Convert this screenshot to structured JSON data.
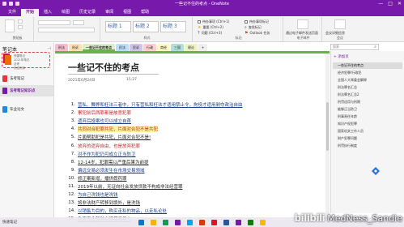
{
  "window": {
    "title": "一些记不住的考点 - OneNote",
    "controls": [
      "—",
      "□",
      "✕"
    ]
  },
  "ribbon_tabs": [
    "文件",
    "开始",
    "插入",
    "绘图",
    "历史记录",
    "审阅",
    "视图",
    "帮助"
  ],
  "ribbon": {
    "clipboard_label": "剪贴板",
    "styles": [
      "标题 1",
      "标题 2",
      "标题 3"
    ],
    "styles_label": "样式",
    "tags": [
      "待办事项 (Ctrl+1)",
      "重要 (Ctrl+2)",
      "问题 (Ctrl+3)"
    ],
    "tags_label": "标记",
    "todo_button": "待办事项标记",
    "find_tags": "查找标记",
    "outlook_tasks": "Outlook 任务",
    "email_page": "通过电子邮件发送页面",
    "email_label": "电子邮件",
    "meeting_details": "会议详细信息",
    "meetings_label": "会议"
  },
  "left_panel": {
    "header": "笔记本",
    "thumb_lines": [
      "快捷笔记",
      "2021年笔记",
      "法考",
      "刑法刑诉"
    ],
    "notebooks": [
      {
        "label": "法考笔记",
        "color": "#e53935"
      },
      {
        "label": "法考笔记知识点",
        "color": "#7719aa"
      },
      {
        "label": "毕业论文",
        "color": "#1e88e5"
      }
    ],
    "footer": "快速笔记"
  },
  "section_tabs": [
    {
      "label": "刑法",
      "color": "#f8bbd0"
    },
    {
      "label": "刑诉",
      "color": "#ffe0b2"
    },
    {
      "label": "一些记不住的考点",
      "color": "#dcedc8"
    },
    {
      "label": "民法",
      "color": "#bbdefb"
    },
    {
      "label": "民诉",
      "color": "#d1c4e9"
    },
    {
      "label": "行政",
      "color": "#ffcdd2"
    },
    {
      "label": "商经",
      "color": "#fff9c4"
    },
    {
      "label": "三国",
      "color": "#b2dfdb"
    },
    {
      "label": "理论",
      "color": "#f0f4c3"
    },
    {
      "label": "+",
      "color": "#eeeeee"
    }
  ],
  "search": {
    "placeholder": "搜索"
  },
  "page": {
    "title": "一些记不住的考点",
    "date": "2021年6月24日",
    "time": "15:27"
  },
  "notes": [
    {
      "num": "1.",
      "text": "营私、舞弊和枉法三者中，只有营私和枉法才适用禁止令，拘役才适用剥夺政治自由",
      "style": "link"
    },
    {
      "num": "2.",
      "text": "累犯前后两罪都是故意犯罪",
      "style": "red"
    },
    {
      "num": "3.",
      "text": "遗弃后投案也可以成立自首",
      "style": "link"
    },
    {
      "num": "4.",
      "text": "共同对合犯罪共犯，片面对合犯不是共犯",
      "style": "red"
    },
    {
      "num": "5.",
      "text": "片面帮助犯是共犯，片面对合犯不是!",
      "style": "dark"
    },
    {
      "num": "6.",
      "text": "放弃的遗弃自由，也是放弃犯罪",
      "style": "red"
    },
    {
      "num": "7.",
      "text": "对不作为犯仍可成立正当防卫",
      "style": "link"
    },
    {
      "num": "8.",
      "text": "12-14岁，犯罪需以严重后果为前提",
      "style": "dark"
    },
    {
      "num": "9.",
      "text": "偏远交易必须发生在市场交易领域",
      "style": "link"
    },
    {
      "num": "10.",
      "text": "修正案新增，播供假药罪",
      "style": "dark"
    },
    {
      "num": "11.",
      "text": "2019年以前，无证向社会发放贷款不构成非法经营罪",
      "style": "dark"
    },
    {
      "num": "12.",
      "text": "为自己洗钱也是洗钱",
      "style": "link"
    },
    {
      "num": "13.",
      "text": "将非法财产转移到境外，是洗钱",
      "style": "dark"
    },
    {
      "num": "14.",
      "text": "以销售为目的，购买走私的物品，以走私论处",
      "style": "link"
    },
    {
      "num": "15.",
      "text": "危害安全驾驶必须使用暴力",
      "style": "dark"
    }
  ],
  "page_list": {
    "add_page": "+ 添加页",
    "items": [
      "一些记不住的考点",
      "经济犯罪/行政犯",
      "全国人大常委会解释",
      "刑法罪名汇总",
      "刑法罪名汇总2",
      "刑罚适用与刑期",
      "能够正当防卫",
      "刑事责任年龄",
      "知识产权犯罪",
      "国家机关工作人员",
      "财产犯罪问题",
      "刑罚执行制度"
    ]
  },
  "status": {
    "left": "快速笔记"
  },
  "watermark": {
    "logo": "bilibili",
    "user": "MedNess_Sandie"
  },
  "taskbar_icons": [
    "#0078d4",
    "#f4b400",
    "#0f9d58",
    "#7719aa",
    "#00a4ef",
    "#d83b01",
    "#e81123",
    "#2b579a",
    "#7719aa",
    "#107c10",
    "#ffb900"
  ],
  "colors": {
    "accent": "#7719aa",
    "highlight": "#fff59d",
    "link": "#1a3d8f",
    "red": "#c62828"
  }
}
